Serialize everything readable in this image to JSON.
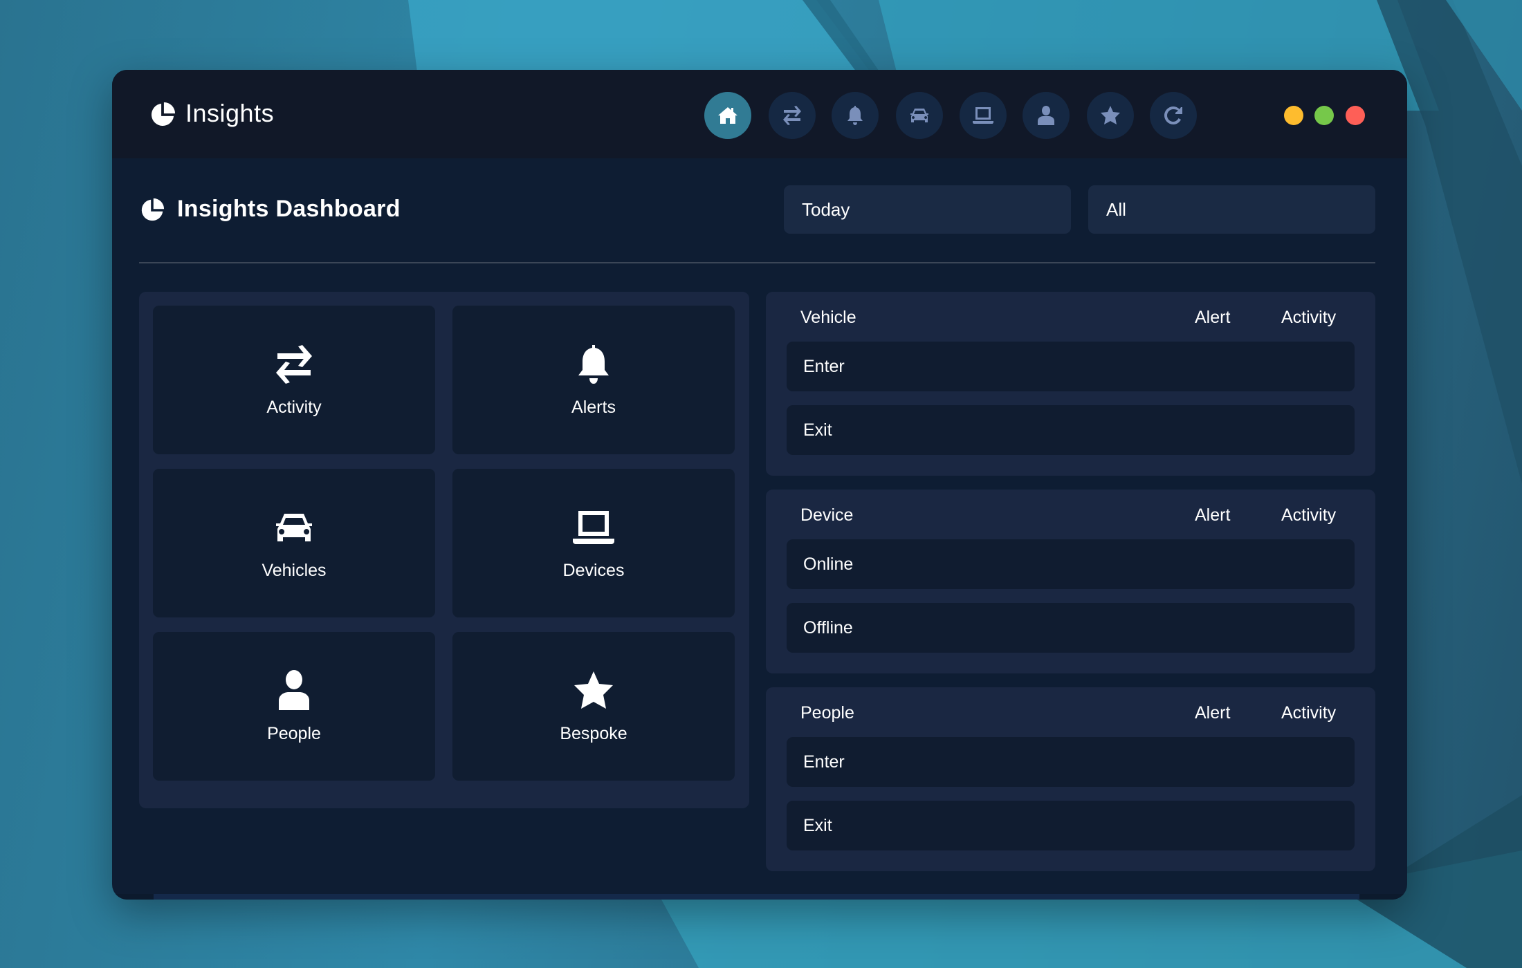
{
  "app": {
    "title": "Insights",
    "logo_icon": "pie-chart-icon"
  },
  "nav": {
    "items": [
      {
        "name": "home",
        "icon": "home-icon",
        "active": true
      },
      {
        "name": "activity",
        "icon": "exchange-arrows-icon",
        "active": false
      },
      {
        "name": "alerts",
        "icon": "bell-icon",
        "active": false
      },
      {
        "name": "vehicles",
        "icon": "car-icon",
        "active": false
      },
      {
        "name": "devices",
        "icon": "laptop-icon",
        "active": false
      },
      {
        "name": "people",
        "icon": "user-icon",
        "active": false
      },
      {
        "name": "bespoke",
        "icon": "star-icon",
        "active": false
      },
      {
        "name": "refresh",
        "icon": "refresh-icon",
        "active": false
      }
    ]
  },
  "window_controls": {
    "minimize_color": "#febc2e",
    "maximize_color": "#76c84a",
    "close_color": "#fe5f57"
  },
  "dashboard": {
    "title": "Insights Dashboard",
    "icon": "pie-chart-icon",
    "period_select": {
      "value": "Today"
    },
    "scope_select": {
      "value": "All"
    }
  },
  "tiles": [
    {
      "label": "Activity",
      "icon": "exchange-arrows-icon"
    },
    {
      "label": "Alerts",
      "icon": "bell-icon"
    },
    {
      "label": "Vehicles",
      "icon": "car-icon"
    },
    {
      "label": "Devices",
      "icon": "laptop-icon"
    },
    {
      "label": "People",
      "icon": "user-icon"
    },
    {
      "label": "Bespoke",
      "icon": "star-icon"
    }
  ],
  "sections": [
    {
      "title": "Vehicle",
      "col_alert": "Alert",
      "col_activity": "Activity",
      "rows": [
        "Enter",
        "Exit"
      ]
    },
    {
      "title": "Device",
      "col_alert": "Alert",
      "col_activity": "Activity",
      "rows": [
        "Online",
        "Offline"
      ]
    },
    {
      "title": "People",
      "col_alert": "Alert",
      "col_activity": "Activity",
      "rows": [
        "Enter",
        "Exit"
      ]
    }
  ],
  "colors": {
    "accent": "#317b94",
    "titlebar_bg": "#111828",
    "content_bg": "#0e1d33",
    "panel_bg": "#1a2742",
    "tile_bg": "#101d31",
    "nav_icon": "#7a8fba"
  }
}
